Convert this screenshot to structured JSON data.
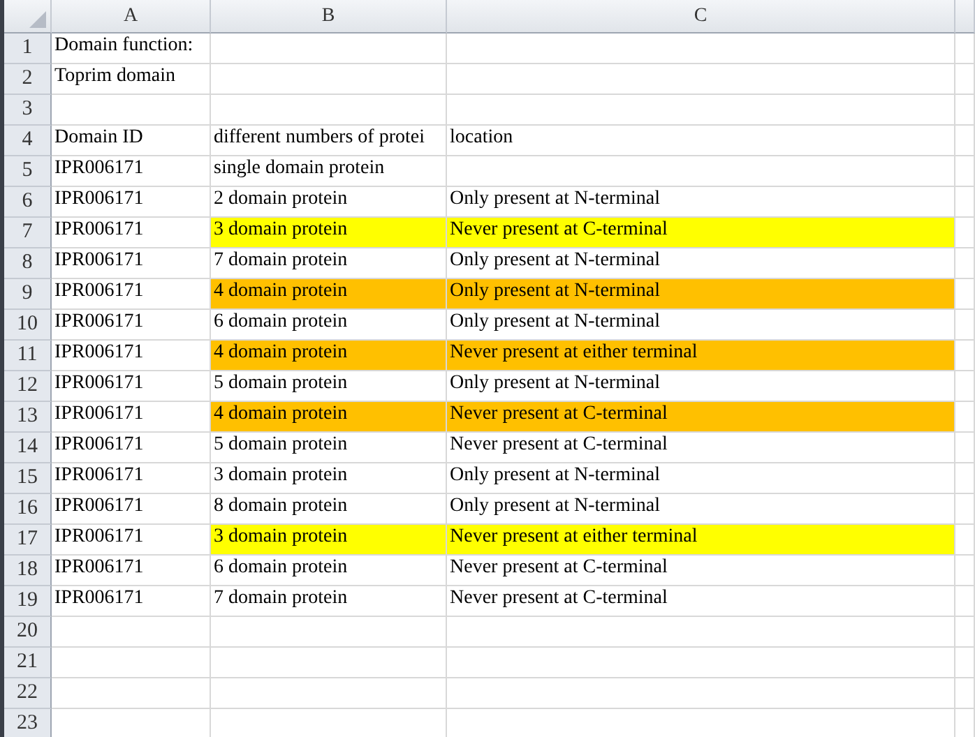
{
  "columns": [
    "A",
    "B",
    "C"
  ],
  "rows": [
    {
      "number": "1",
      "a": "Domain function:"
    },
    {
      "number": "2",
      "a": "Toprim domain"
    },
    {
      "number": "3"
    },
    {
      "number": "4",
      "a": "Domain ID",
      "b": "different numbers of protei",
      "c": "location"
    },
    {
      "number": "5",
      "a": "IPR006171",
      "b": "single domain protein"
    },
    {
      "number": "6",
      "a": "IPR006171",
      "b": "2 domain protein",
      "c": "Only present at N-terminal"
    },
    {
      "number": "7",
      "a": "IPR006171",
      "b": "3 domain protein",
      "c": "Never present at C-terminal",
      "color": "#ffff00"
    },
    {
      "number": "8",
      "a": "IPR006171",
      "b": "7 domain protein",
      "c": "Only present at N-terminal"
    },
    {
      "number": "9",
      "a": "IPR006171",
      "b": "4 domain protein",
      "c": "Only present at N-terminal",
      "color": "#ffc000"
    },
    {
      "number": "10",
      "a": "IPR006171",
      "b": "6 domain protein",
      "c": "Only present at N-terminal"
    },
    {
      "number": "11",
      "a": "IPR006171",
      "b": "4 domain protein",
      "c": "Never present at either terminal",
      "color": "#ffc000"
    },
    {
      "number": "12",
      "a": "IPR006171",
      "b": "5 domain protein",
      "c": "Only present at N-terminal"
    },
    {
      "number": "13",
      "a": "IPR006171",
      "b": "4 domain protein",
      "c": "Never present at C-terminal",
      "color": "#ffc000"
    },
    {
      "number": "14",
      "a": "IPR006171",
      "b": "5 domain protein",
      "c": "Never present at C-terminal"
    },
    {
      "number": "15",
      "a": "IPR006171",
      "b": "3 domain protein",
      "c": "Only present at N-terminal"
    },
    {
      "number": "16",
      "a": "IPR006171",
      "b": "8 domain protein",
      "c": "Only present at N-terminal"
    },
    {
      "number": "17",
      "a": "IPR006171",
      "b": "3 domain protein",
      "c": "Never present at either terminal",
      "color": "#ffff00"
    },
    {
      "number": "18",
      "a": "IPR006171",
      "b": "6 domain protein",
      "c": "Never present at C-terminal"
    },
    {
      "number": "19",
      "a": "IPR006171",
      "b": "7 domain protein",
      "c": "Never present at C-terminal"
    },
    {
      "number": "20"
    },
    {
      "number": "21"
    },
    {
      "number": "22"
    },
    {
      "number": "23"
    }
  ]
}
